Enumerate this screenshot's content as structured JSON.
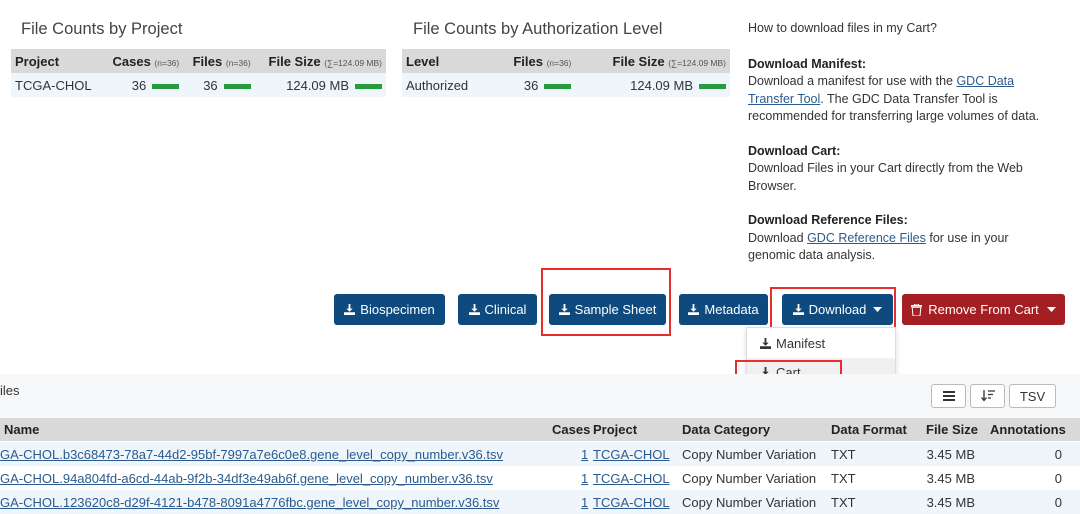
{
  "project_panel": {
    "title": "File Counts by Project",
    "headers": {
      "project": "Project",
      "cases": "Cases",
      "cases_note": "(n=36)",
      "files": "Files",
      "files_note": "(n=36)",
      "file_size": "File Size",
      "file_size_note": "(∑=124.09 MB)"
    },
    "row": {
      "project": "TCGA-CHOL",
      "cases": "36",
      "files": "36",
      "file_size": "124.09 MB"
    }
  },
  "auth_panel": {
    "title": "File Counts by Authorization Level",
    "headers": {
      "level": "Level",
      "files": "Files",
      "files_note": "(n=36)",
      "file_size": "File Size",
      "file_size_note": "(∑=124.09 MB)"
    },
    "row": {
      "level": "Authorized",
      "files": "36",
      "file_size": "124.09 MB"
    }
  },
  "help": {
    "question": "How to download files in my Cart?",
    "manifest_title": "Download Manifest:",
    "manifest_p1": "Download a manifest for use with the ",
    "manifest_link": "GDC Data Transfer Tool",
    "manifest_p2": ". The GDC Data Transfer Tool is recommended for transferring large volumes of data.",
    "cart_title": "Download Cart:",
    "cart_text": "Download Files in your Cart directly from the Web Browser.",
    "ref_title": "Download Reference Files:",
    "ref_p1": "Download ",
    "ref_link": "GDC Reference Files",
    "ref_p2": " for use in your genomic data analysis."
  },
  "buttons": {
    "biospecimen": "Biospecimen",
    "clinical": "Clinical",
    "sample_sheet": "Sample Sheet",
    "metadata": "Metadata",
    "download": "Download",
    "remove": "Remove From Cart"
  },
  "dropdown": {
    "manifest": "Manifest",
    "cart": "Cart"
  },
  "files_section": {
    "label": "iles",
    "tsv": "TSV"
  },
  "table": {
    "headers": {
      "name": "Name",
      "cases": "Cases",
      "project": "Project",
      "category": "Data Category",
      "format": "Data Format",
      "size": "File Size",
      "annotations": "Annotations"
    },
    "rows": [
      {
        "name": "GA-CHOL.b3c68473-78a7-44d2-95bf-7997a7e6c0e8.gene_level_copy_number.v36.tsv",
        "cases": "1",
        "project": "TCGA-CHOL",
        "category": "Copy Number Variation",
        "format": "TXT",
        "size": "3.45 MB",
        "annotations": "0"
      },
      {
        "name": "GA-CHOL.94a804fd-a6cd-44ab-9f2b-34df3e49ab6f.gene_level_copy_number.v36.tsv",
        "cases": "1",
        "project": "TCGA-CHOL",
        "category": "Copy Number Variation",
        "format": "TXT",
        "size": "3.45 MB",
        "annotations": "0"
      },
      {
        "name": "GA-CHOL.123620c8-d29f-4121-b478-8091a4776fbc.gene_level_copy_number.v36.tsv",
        "cases": "1",
        "project": "TCGA-CHOL",
        "category": "Copy Number Variation",
        "format": "TXT",
        "size": "3.45 MB",
        "annotations": "0"
      }
    ]
  },
  "colors": {
    "primary_button": "#0e4a7e",
    "danger_button": "#a41f24",
    "bar": "#2a9a3f",
    "highlight": "#e52e2e"
  }
}
